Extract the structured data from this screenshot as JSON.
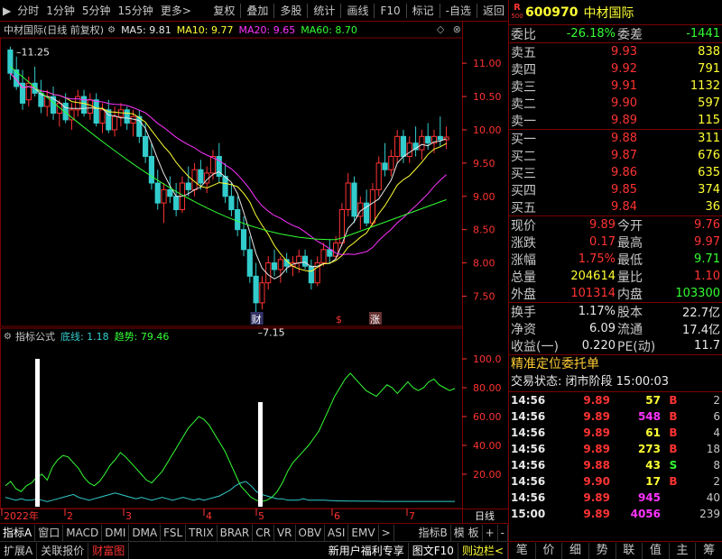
{
  "toolbar": {
    "left": [
      "分时",
      "1分钟",
      "5分钟",
      "15分钟",
      "更多>"
    ],
    "right": [
      "复权",
      "叠加",
      "多股",
      "统计",
      "画线",
      "F10",
      "标记",
      "-自选",
      "返回"
    ]
  },
  "main": {
    "name": "中材国际(日线 前复权)",
    "ma5": "MA5: 9.81",
    "ma10": "MA10: 9.77",
    "ma20": "MA20: 9.65",
    "ma60": "MA60: 8.70",
    "hdr_icons": [
      "◇",
      "⊗"
    ],
    "high_label": "11.25",
    "low_label": "7.15",
    "marker_cai": "财",
    "marker_dollar": "$",
    "marker_zhang": "涨",
    "price_axis": [
      {
        "label": "11.00",
        "value": 11.0
      },
      {
        "label": "10.50",
        "value": 10.5
      },
      {
        "label": "10.00",
        "value": 10.0
      },
      {
        "label": "9.50",
        "value": 9.5
      },
      {
        "label": "9.00",
        "value": 9.0
      },
      {
        "label": "8.50",
        "value": 8.5
      },
      {
        "label": "8.00",
        "value": 8.0
      },
      {
        "label": "7.50",
        "value": 7.5
      }
    ]
  },
  "indicator": {
    "name": "指标公式",
    "dixian": "底线: 1.18",
    "qushi": "趋势: 79.46",
    "axis": [
      {
        "label": "100.0",
        "value": 100
      },
      {
        "label": "80.00",
        "value": 80
      },
      {
        "label": "60.00",
        "value": 60
      },
      {
        "label": "40.00",
        "value": 40
      },
      {
        "label": "20.00",
        "value": 20
      }
    ]
  },
  "xaxis": {
    "labels": [
      "2022年",
      "2",
      "3",
      "4",
      "5",
      "6",
      "7"
    ],
    "right_label": "日线"
  },
  "tabs1": [
    "指标A",
    "窗口",
    "MACD",
    "DMI",
    "DMA",
    "FSL",
    "TRIX",
    "BRAR",
    "CR",
    "VR",
    "OBV",
    "ASI",
    "EMV",
    ">",
    "指标B",
    "模 板",
    "+",
    "-"
  ],
  "tabs2": {
    "left": [
      "扩展A",
      "关联报价",
      "财富图"
    ],
    "right": [
      "新用户福利专享",
      "图文F10",
      "则边栏<"
    ]
  },
  "panel": {
    "badge_r": "R",
    "badge_n": "500",
    "code": "600970",
    "name": "中材国际",
    "weibi_label": "委比",
    "weibi": "-26.18%",
    "weicha_label": "委差",
    "weicha": "-1441",
    "asks": [
      {
        "label": "卖五",
        "price": "9.93",
        "vol": "838"
      },
      {
        "label": "卖四",
        "price": "9.92",
        "vol": "791"
      },
      {
        "label": "卖三",
        "price": "9.91",
        "vol": "1132"
      },
      {
        "label": "卖二",
        "price": "9.90",
        "vol": "597"
      },
      {
        "label": "卖一",
        "price": "9.89",
        "vol": "115"
      }
    ],
    "bids": [
      {
        "label": "买一",
        "price": "9.88",
        "vol": "311"
      },
      {
        "label": "买二",
        "price": "9.87",
        "vol": "676"
      },
      {
        "label": "买三",
        "price": "9.86",
        "vol": "635"
      },
      {
        "label": "买四",
        "price": "9.85",
        "vol": "374"
      },
      {
        "label": "买五",
        "price": "9.84",
        "vol": "36"
      }
    ],
    "quote": [
      {
        "l1": "现价",
        "v1": "9.89",
        "c1": "red",
        "l2": "今开",
        "v2": "9.76",
        "c2": "red"
      },
      {
        "l1": "涨跌",
        "v1": "0.17",
        "c1": "red",
        "l2": "最高",
        "v2": "9.97",
        "c2": "red"
      },
      {
        "l1": "涨幅",
        "v1": "1.75%",
        "c1": "red",
        "l2": "最低",
        "v2": "9.71",
        "c2": "green"
      },
      {
        "l1": "总量",
        "v1": "204614",
        "c1": "yellow",
        "l2": "量比",
        "v2": "1.10",
        "c2": "red"
      },
      {
        "l1": "外盘",
        "v1": "101314",
        "c1": "red",
        "l2": "内盘",
        "v2": "103300",
        "c2": "green"
      }
    ],
    "stats": [
      {
        "l1": "换手",
        "v1": "1.17%",
        "l2": "股本",
        "v2": "22.7亿"
      },
      {
        "l1": "净资",
        "v1": "6.09",
        "l2": "流通",
        "v2": "17.4亿"
      },
      {
        "l1": "收益(一)",
        "v1": "0.220",
        "l2": "PE(动)",
        "v2": "11.7"
      }
    ],
    "section_title": "精准定位委托单",
    "status_label": "交易状态: 闭市阶段",
    "status_time": "15:00:03",
    "ticks": [
      {
        "t": "14:56",
        "p": "9.89",
        "v": "57",
        "vc": "yellow",
        "d": "B",
        "dc": "red",
        "n": "2"
      },
      {
        "t": "14:56",
        "p": "9.89",
        "v": "548",
        "vc": "magenta",
        "d": "B",
        "dc": "red",
        "n": "6"
      },
      {
        "t": "14:56",
        "p": "9.89",
        "v": "61",
        "vc": "yellow",
        "d": "B",
        "dc": "red",
        "n": "4"
      },
      {
        "t": "14:56",
        "p": "9.89",
        "v": "273",
        "vc": "yellow",
        "d": "B",
        "dc": "red",
        "n": "18"
      },
      {
        "t": "14:56",
        "p": "9.88",
        "v": "43",
        "vc": "yellow",
        "d": "S",
        "dc": "green",
        "n": "8"
      },
      {
        "t": "14:56",
        "p": "9.90",
        "v": "17",
        "vc": "yellow",
        "d": "B",
        "dc": "red",
        "n": "2"
      },
      {
        "t": "14:56",
        "p": "9.89",
        "v": "945",
        "vc": "magenta",
        "d": "",
        "dc": "red",
        "n": "40"
      },
      {
        "t": "15:00",
        "p": "9.89",
        "v": "4056",
        "vc": "magenta",
        "d": "",
        "dc": "red",
        "n": "239"
      }
    ],
    "footer": [
      "笔",
      "价",
      "细",
      "势",
      "联",
      "值",
      "主",
      "筹"
    ]
  },
  "colors": {
    "up": "#ff3333",
    "down": "#33cccc",
    "ma5": "#e8e8e8",
    "ma10": "#ffff33",
    "ma20": "#ff33ff",
    "ma60": "#33ff33",
    "frame": "#7a0000"
  },
  "chart_data": {
    "type": "candlestick",
    "ylim": [
      7.1,
      11.3
    ],
    "candles": [
      [
        11.2,
        11.25,
        10.75,
        10.85
      ],
      [
        10.9,
        11.1,
        10.6,
        10.65
      ],
      [
        10.7,
        10.9,
        10.3,
        10.4
      ],
      [
        10.45,
        10.8,
        10.35,
        10.7
      ],
      [
        10.7,
        10.95,
        10.5,
        10.55
      ],
      [
        10.55,
        10.75,
        10.25,
        10.35
      ],
      [
        10.35,
        10.6,
        10.2,
        10.5
      ],
      [
        10.5,
        10.65,
        10.15,
        10.25
      ],
      [
        10.25,
        10.45,
        10.05,
        10.4
      ],
      [
        10.4,
        10.55,
        10.1,
        10.15
      ],
      [
        10.15,
        10.4,
        10.0,
        10.3
      ],
      [
        10.3,
        10.6,
        10.2,
        10.5
      ],
      [
        10.5,
        10.6,
        10.2,
        10.25
      ],
      [
        10.25,
        10.55,
        10.15,
        10.45
      ],
      [
        10.45,
        10.55,
        10.05,
        10.1
      ],
      [
        10.1,
        10.4,
        9.95,
        10.3
      ],
      [
        10.3,
        10.45,
        9.95,
        10.0
      ],
      [
        10.0,
        10.35,
        9.9,
        10.2
      ],
      [
        10.2,
        10.4,
        10.05,
        10.3
      ],
      [
        10.3,
        10.35,
        10.0,
        10.1
      ],
      [
        10.1,
        10.3,
        9.9,
        10.2
      ],
      [
        10.2,
        10.3,
        9.8,
        9.9
      ],
      [
        9.9,
        10.1,
        9.5,
        9.6
      ],
      [
        9.6,
        9.8,
        9.1,
        9.2
      ],
      [
        9.2,
        9.4,
        8.8,
        8.9
      ],
      [
        8.9,
        9.2,
        8.6,
        9.1
      ],
      [
        9.1,
        9.3,
        8.9,
        9.0
      ],
      [
        9.0,
        9.2,
        8.7,
        8.8
      ],
      [
        8.8,
        9.3,
        8.75,
        9.2
      ],
      [
        9.2,
        9.45,
        9.0,
        9.1
      ],
      [
        9.1,
        9.5,
        9.0,
        9.4
      ],
      [
        9.4,
        9.55,
        9.1,
        9.2
      ],
      [
        9.2,
        9.45,
        9.05,
        9.35
      ],
      [
        9.35,
        9.7,
        9.25,
        9.6
      ],
      [
        9.6,
        9.8,
        9.2,
        9.3
      ],
      [
        9.3,
        9.5,
        8.9,
        9.0
      ],
      [
        9.0,
        9.2,
        8.7,
        8.8
      ],
      [
        8.8,
        9.0,
        8.4,
        8.5
      ],
      [
        8.5,
        8.7,
        8.1,
        8.2
      ],
      [
        8.2,
        8.4,
        7.7,
        7.8
      ],
      [
        7.8,
        8.0,
        7.15,
        7.4
      ],
      [
        7.4,
        7.8,
        7.3,
        7.7
      ],
      [
        7.7,
        8.1,
        7.6,
        8.0
      ],
      [
        8.0,
        8.2,
        7.8,
        7.9
      ],
      [
        7.9,
        8.1,
        7.7,
        8.05
      ],
      [
        8.05,
        8.15,
        7.85,
        7.95
      ],
      [
        7.95,
        8.1,
        7.8,
        8.0
      ],
      [
        8.0,
        8.2,
        7.85,
        8.1
      ],
      [
        8.1,
        8.2,
        7.9,
        7.95
      ],
      [
        7.95,
        8.05,
        7.6,
        7.7
      ],
      [
        7.7,
        8.1,
        7.65,
        8.0
      ],
      [
        8.0,
        8.3,
        7.95,
        8.2
      ],
      [
        8.2,
        8.35,
        8.0,
        8.1
      ],
      [
        8.1,
        8.4,
        8.05,
        8.3
      ],
      [
        8.3,
        8.9,
        8.25,
        8.8
      ],
      [
        8.8,
        9.35,
        8.7,
        9.2
      ],
      [
        9.2,
        9.3,
        8.6,
        8.7
      ],
      [
        8.7,
        9.0,
        8.5,
        8.9
      ],
      [
        8.9,
        9.1,
        8.55,
        8.6
      ],
      [
        8.6,
        9.2,
        8.55,
        9.1
      ],
      [
        9.1,
        9.6,
        9.0,
        9.5
      ],
      [
        9.5,
        9.8,
        9.3,
        9.4
      ],
      [
        9.4,
        9.7,
        9.3,
        9.6
      ],
      [
        9.6,
        10.0,
        9.5,
        9.9
      ],
      [
        9.9,
        10.0,
        9.5,
        9.6
      ],
      [
        9.6,
        9.9,
        9.5,
        9.8
      ],
      [
        9.8,
        10.05,
        9.6,
        9.7
      ],
      [
        9.7,
        10.0,
        9.55,
        9.9
      ],
      [
        9.9,
        10.1,
        9.7,
        9.8
      ],
      [
        9.8,
        10.0,
        9.65,
        9.9
      ],
      [
        9.9,
        10.2,
        9.75,
        9.85
      ],
      [
        9.85,
        10.05,
        9.71,
        9.89
      ]
    ],
    "trend": [
      12,
      15,
      10,
      8,
      12,
      14,
      18,
      20,
      16,
      25,
      30,
      33,
      32,
      28,
      24,
      18,
      14,
      12,
      15,
      20,
      26,
      30,
      35,
      32,
      28,
      24,
      20,
      16,
      14,
      18,
      22,
      28,
      34,
      40,
      46,
      52,
      56,
      60,
      58,
      54,
      48,
      42,
      36,
      28,
      20,
      12,
      8,
      4,
      2,
      1,
      2,
      4,
      8,
      14,
      22,
      28,
      32,
      36,
      40,
      45,
      50,
      58,
      66,
      74,
      80,
      86,
      90,
      86,
      82,
      78,
      76,
      74,
      78,
      82,
      80,
      76,
      80,
      84,
      80,
      78,
      80,
      84,
      86,
      82,
      80,
      78,
      79.46
    ],
    "baseline": [
      4,
      3,
      2,
      3,
      2,
      2,
      3,
      2,
      1,
      2,
      3,
      4,
      5,
      6,
      4,
      3,
      2,
      3,
      4,
      5,
      6,
      7,
      6,
      5,
      4,
      3,
      4,
      3,
      2,
      3,
      4,
      3,
      2,
      3,
      4,
      3,
      2,
      3,
      2,
      3,
      4,
      5,
      7,
      9,
      12,
      14,
      15,
      12,
      8,
      6,
      5,
      4,
      3,
      3,
      2,
      2,
      2,
      3,
      2,
      2,
      2,
      2,
      1.8,
      1.6,
      1.5,
      1.5,
      1.4,
      1.4,
      1.3,
      1.3,
      1.3,
      1.3,
      1.2,
      1.2,
      1.2,
      1.2,
      1.2,
      1.2,
      1.2,
      1.2,
      1.2,
      1.2,
      1.18,
      1.18,
      1.18,
      1.18,
      1.18
    ],
    "bars": [
      {
        "x": 41,
        "value": 100
      },
      {
        "x": 288,
        "value": 70
      }
    ]
  }
}
